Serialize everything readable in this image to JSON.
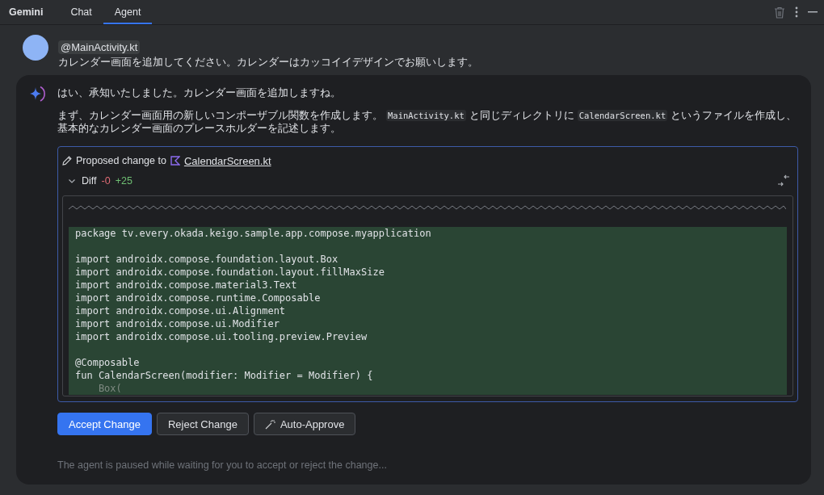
{
  "header": {
    "title": "Gemini",
    "tabs": [
      {
        "label": "Chat",
        "selected": false
      },
      {
        "label": "Agent",
        "selected": true
      }
    ]
  },
  "user_message": {
    "mention": "@MainActivity.kt",
    "text": "カレンダー画面を追加してください。カレンダーはカッコイイデザインでお願いします。"
  },
  "agent_message": {
    "intro": "はい、承知いたしました。カレンダー画面を追加しますね。",
    "paragraph": [
      {
        "kind": "text",
        "text": "まず、カレンダー画面用の新しいコンポーザブル関数を作成します。 "
      },
      {
        "kind": "code",
        "text": "MainActivity.kt"
      },
      {
        "kind": "text",
        "text": " と同じディレクトリに "
      },
      {
        "kind": "code",
        "text": "CalendarScreen.kt"
      },
      {
        "kind": "text",
        "text": " というファイルを作成し、基本的なカレンダー画面のプレースホルダーを記述します。"
      }
    ],
    "proposal": {
      "label": "Proposed change to",
      "file": "CalendarScreen.kt",
      "diff_label": "Diff",
      "removed": "-0",
      "added": "+25",
      "expanded": true,
      "lines": [
        {
          "kind": "code",
          "text": "package tv.every.okada.keigo.sample.app.compose.myapplication"
        },
        {
          "kind": "blank"
        },
        {
          "kind": "code",
          "text": "import androidx.compose.foundation.layout.Box"
        },
        {
          "kind": "code",
          "text": "import androidx.compose.foundation.layout.fillMaxSize"
        },
        {
          "kind": "code",
          "text": "import androidx.compose.material3.Text"
        },
        {
          "kind": "code",
          "text": "import androidx.compose.runtime.Composable"
        },
        {
          "kind": "code",
          "text": "import androidx.compose.ui.Alignment"
        },
        {
          "kind": "code",
          "text": "import androidx.compose.ui.Modifier"
        },
        {
          "kind": "code",
          "text": "import androidx.compose.ui.tooling.preview.Preview"
        },
        {
          "kind": "blank"
        },
        {
          "kind": "code",
          "text": "@Composable"
        },
        {
          "kind": "code",
          "text": "fun CalendarScreen(modifier: Modifier = Modifier) {"
        },
        {
          "kind": "faded",
          "text": "    Box("
        }
      ]
    },
    "buttons": [
      {
        "kind": "primary",
        "label": "Accept Change"
      },
      {
        "kind": "secondary",
        "label": "Reject Change"
      },
      {
        "kind": "wand",
        "label": "Auto-Approve"
      }
    ],
    "status": "The agent is paused while waiting for you to accept or reject the change..."
  }
}
